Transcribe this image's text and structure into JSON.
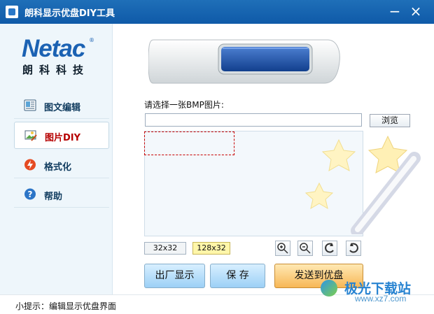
{
  "window": {
    "title": "朗科显示优盘DIY工具",
    "minimize_label": "−",
    "close_label": "×"
  },
  "brand": {
    "logo": "Netac",
    "registered": "®",
    "name": "朗科科技"
  },
  "sidebar": {
    "items": [
      {
        "label": "图文编辑",
        "icon": "image-text-edit-icon",
        "active": false
      },
      {
        "label": "图片DIY",
        "icon": "picture-diy-icon",
        "active": true
      },
      {
        "label": "格式化",
        "icon": "format-lightning-icon",
        "active": false
      },
      {
        "label": "帮助",
        "icon": "help-question-icon",
        "active": false
      }
    ]
  },
  "main": {
    "choose_label": "请选择一张BMP图片:",
    "path_value": "",
    "browse_label": "浏览",
    "size_options": [
      "32x32",
      "128x32"
    ],
    "tool_icons": [
      "zoom-in-icon",
      "zoom-out-icon",
      "rotate-left-icon",
      "rotate-right-icon"
    ],
    "actions": [
      "出厂显示",
      "保 存",
      "发送到优盘"
    ]
  },
  "status": {
    "text": "小提示：编辑显示优盘界面"
  },
  "watermark": {
    "title": "极光下载站",
    "url": "www.xz7.com"
  },
  "colors": {
    "titlebar": "#1565b6",
    "brand": "#1b62b3",
    "active_nav": "#b60000",
    "selected_size": "#fff6a9"
  }
}
